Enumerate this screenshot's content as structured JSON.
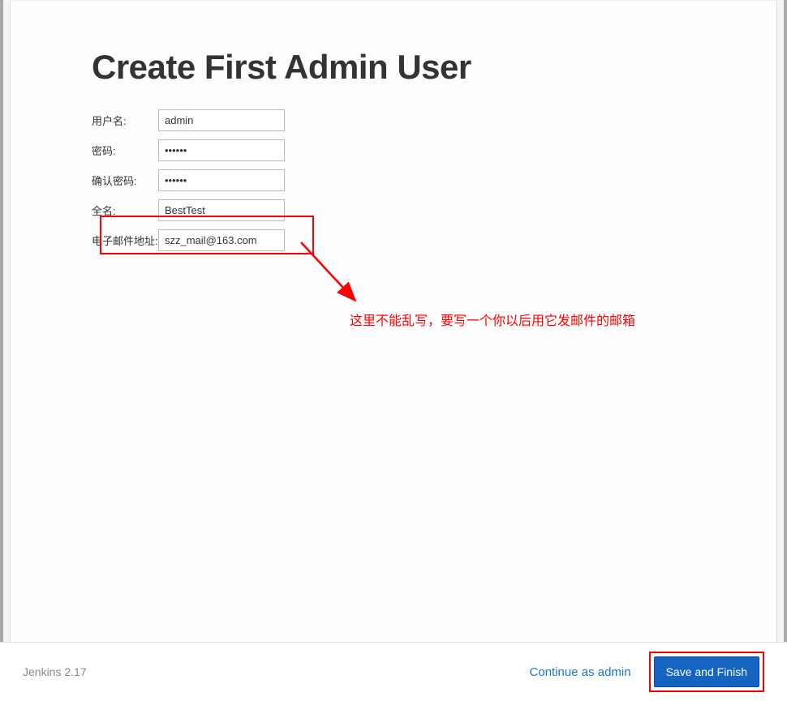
{
  "title": "Create First Admin User",
  "form": {
    "username": {
      "label": "用户名:",
      "value": "admin"
    },
    "password": {
      "label": "密码:",
      "value": "••••••"
    },
    "confirm_password": {
      "label": "确认密码:",
      "value": "••••••"
    },
    "fullname": {
      "label": "全名:",
      "value": "BestTest"
    },
    "email": {
      "label": "电子邮件地址:",
      "value": "szz_mail@163.com"
    }
  },
  "annotation": {
    "text": "这里不能乱写，要写一个你以后用它发邮件的邮箱"
  },
  "footer": {
    "version": "Jenkins 2.17",
    "continue_label": "Continue as admin",
    "save_label": "Save and Finish"
  }
}
